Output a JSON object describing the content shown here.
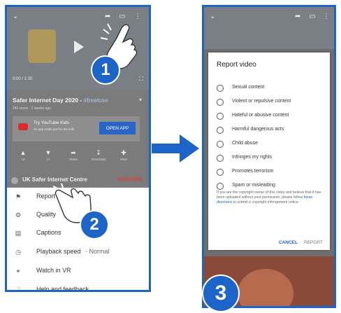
{
  "left_phone": {
    "video": {
      "time": "0:00 / 1:30"
    },
    "title": "Safer Internet Day 2020 - ",
    "title_tag": "#freelose",
    "meta": "240 views · 2 weeks ago",
    "promo": {
      "title": "Try YouTube Kids",
      "subtitle": "An app made just for the kids.",
      "button": "OPEN APP"
    },
    "actions": [
      {
        "icon": "thumbs-up-icon",
        "label": "13"
      },
      {
        "icon": "thumbs-down-icon",
        "label": "12"
      },
      {
        "icon": "share-icon",
        "label": "Share"
      },
      {
        "icon": "download-icon",
        "label": "Download"
      },
      {
        "icon": "save-icon",
        "label": "Save"
      }
    ],
    "channel": {
      "name": "UK Safer Internet Centre",
      "subscribe": "SUBSCRIBE"
    },
    "menu": [
      {
        "icon": "flag-icon",
        "label": "Report"
      },
      {
        "icon": "gear-icon",
        "label": "Quality"
      },
      {
        "icon": "captions-icon",
        "label": "Captions"
      },
      {
        "icon": "playback-speed-icon",
        "label": "Playback speed",
        "extra": "·  Normal"
      },
      {
        "icon": "vr-icon",
        "label": "Watch in VR"
      },
      {
        "icon": "help-icon",
        "label": "Help and feedback"
      }
    ]
  },
  "steps": [
    "1",
    "2",
    "3"
  ],
  "dialog": {
    "title": "Report video",
    "options": [
      "Sexual content",
      "Violent or repulsive content",
      "Hateful or abusive content",
      "Harmful dangerous acts",
      "Child abuse",
      "Infringes my rights",
      "Promotes terrorism",
      "Spam or misleading"
    ],
    "notice_before": "If you are the copyright owner of this video and believe that it has been uploaded without your permission, please follow ",
    "notice_link": "these directions",
    "notice_after": " to submit a copyright infringement notice.",
    "cancel": "CANCEL",
    "report": "REPORT"
  },
  "colors": {
    "accent": "#1c64c8",
    "dim_overlay": "#7b7b7b",
    "kids_red": "#d92b2b"
  }
}
